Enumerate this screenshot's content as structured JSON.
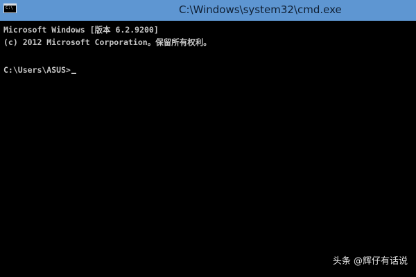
{
  "window": {
    "title": "C:\\Windows\\system32\\cmd.exe",
    "icon": "cmd-console-icon",
    "icon_text": "C:\\",
    "titlebar_color": "#5e96d2"
  },
  "console": {
    "lines": [
      "Microsoft Windows [版本 6.2.9200]",
      "(c) 2012 Microsoft Corporation。保留所有权利。"
    ],
    "prompt": "C:\\Users\\ASUS>",
    "text_color": "#c6c6c6",
    "background_color": "#000000"
  },
  "watermark": {
    "text": "头条 @辉仔有话说"
  }
}
